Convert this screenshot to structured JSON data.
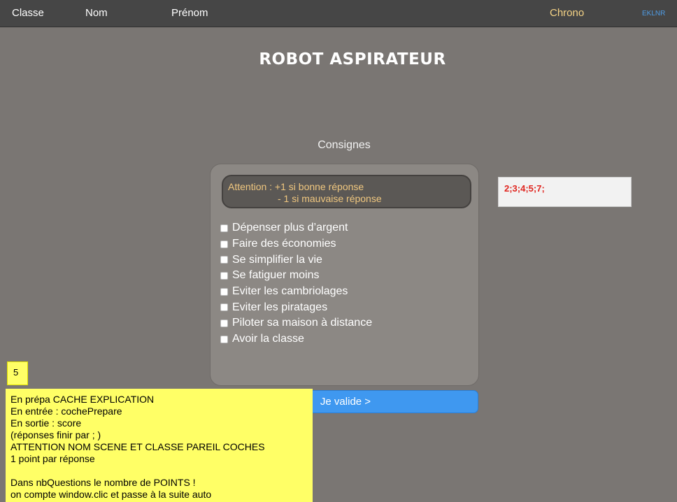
{
  "header": {
    "classe": "Classe",
    "nom": "Nom",
    "prenom": "Prénom",
    "chrono": "Chrono",
    "code": "EKLNR"
  },
  "title": "ROBOT ASPIRATEUR",
  "consignes": "Consignes",
  "attention": {
    "line1": "Attention : +1 si bonne réponse",
    "line2": "- 1 si mauvaise réponse"
  },
  "options": [
    "Dépenser plus d’argent",
    "Faire des économies",
    "Se simplifier la vie",
    "Se fatiguer moins",
    "Eviter les cambriolages",
    "Eviter les piratages",
    "Piloter sa maison à distance",
    "Avoir la classe"
  ],
  "answer_box": "2;3;4;5;7;",
  "validate_label": "Je valide >",
  "score": "5",
  "notes": [
    "En prépa CACHE EXPLICATION",
    "En entrée : cochePrepare",
    "En sortie : score",
    "(réponses finir par ; )",
    "ATTENTION NOM SCENE ET CLASSE PAREIL COCHES",
    "1 point par réponse",
    "",
    "Dans nbQuestions le nombre de POINTS !",
    "on compte window.clic et  passe à la suite auto"
  ],
  "colors": {
    "background": "#7a7673",
    "topbar": "#464646",
    "accent_blue": "#3f98f0",
    "chrono": "#f6d486",
    "attention_text": "#f0c77f",
    "answer_text": "#e0251f",
    "note_yellow": "#ffff66"
  }
}
